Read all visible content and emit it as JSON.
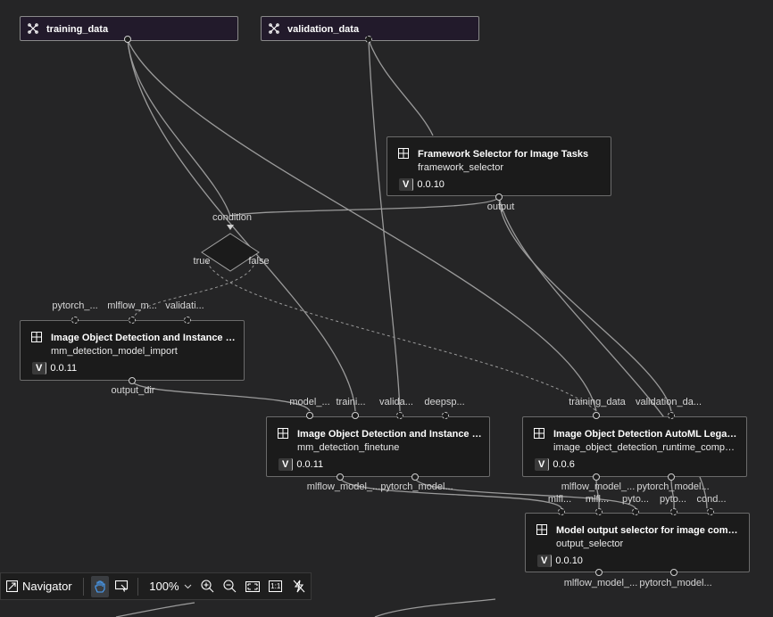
{
  "nodes": {
    "training_data": {
      "title": "training_data",
      "icon": "dataset-icon"
    },
    "validation_data": {
      "title": "validation_data",
      "icon": "dataset-icon"
    },
    "framework_selector": {
      "title": "Framework Selector for Image Tasks",
      "subtitle": "framework_selector",
      "version_label": "V",
      "version": "0.0.10",
      "outputs": [
        "output"
      ]
    },
    "condition": {
      "input": "condition",
      "true_label": "true",
      "false_label": "false"
    },
    "mm_import": {
      "title": "Image Object Detection and Instance Se...",
      "subtitle": "mm_detection_model_import",
      "version_label": "V",
      "version": "0.0.11",
      "inputs": [
        "pytorch_...",
        "mlflow_m...",
        "validati..."
      ],
      "outputs": [
        "output_dir"
      ]
    },
    "mm_finetune": {
      "title": "Image Object Detection and Instance Se...",
      "subtitle": "mm_detection_finetune",
      "version_label": "V",
      "version": "0.0.11",
      "inputs": [
        "model_...",
        "traini...",
        "valida...",
        "deepsp..."
      ],
      "outputs": [
        "mlflow_model_...",
        "pytorch_model..."
      ]
    },
    "automl_legacy": {
      "title": "Image Object Detection AutoML Legacy ...",
      "subtitle": "image_object_detection_runtime_compon...",
      "version_label": "V",
      "version": "0.0.6",
      "inputs": [
        "training_data",
        "validation_da..."
      ],
      "outputs": [
        "mlflow_model_...",
        "pytorch_model..."
      ]
    },
    "output_selector": {
      "title": "Model output selector for image compo...",
      "subtitle": "output_selector",
      "version_label": "V",
      "version": "0.0.10",
      "inputs": [
        "mlfl...",
        "mlfl...",
        "pyto...",
        "pyto...",
        "cond..."
      ],
      "outputs": [
        "mlflow_model_...",
        "pytorch_model..."
      ]
    }
  },
  "toolbar": {
    "navigator_label": "Navigator",
    "zoom": "100%",
    "fit_label": "1:1"
  },
  "colors": {
    "edge": "#9a9a9a",
    "canvas": "#252526",
    "node_bg": "#1b1b1b",
    "dataset_bg": "#221a2b"
  }
}
